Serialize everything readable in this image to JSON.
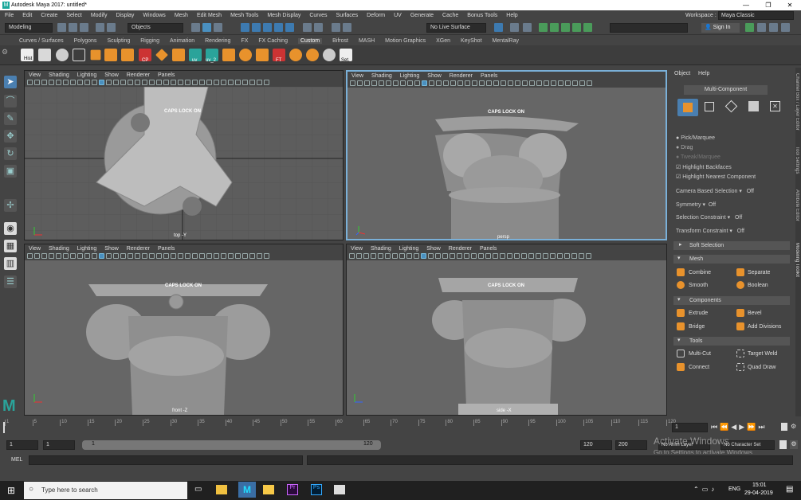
{
  "window": {
    "title": "Autodesk Maya 2017: untitled*"
  },
  "menu": [
    "File",
    "Edit",
    "Create",
    "Select",
    "Modify",
    "Display",
    "Windows",
    "Mesh",
    "Edit Mesh",
    "Mesh Tools",
    "Mesh Display",
    "Curves",
    "Surfaces",
    "Deform",
    "UV",
    "Generate",
    "Cache",
    "Bonus Tools",
    "Help"
  ],
  "workspace": {
    "label": "Workspace :",
    "value": "Maya Classic"
  },
  "status": {
    "mode": "Modeling",
    "objects": "Objects",
    "live": "No Live Surface",
    "signin": "Sign In"
  },
  "shelf_tabs": [
    "Curves / Surfaces",
    "Polygons",
    "Sculpting",
    "Rigging",
    "Animation",
    "Rendering",
    "FX",
    "FX Caching",
    "Custom",
    "Bifrost",
    "MASH",
    "Motion Graphics",
    "XGen",
    "KeyShot",
    "MentalRay"
  ],
  "shelf_active": "Custom",
  "shelf_labels": {
    "hist": "Hist",
    "cp": "CP",
    "uv": "uv",
    "uv2": "uv_2",
    "ft": "FT",
    "set": "Set."
  },
  "viewport_menu": [
    "View",
    "Shading",
    "Lighting",
    "Show",
    "Renderer",
    "Panels"
  ],
  "viewports": [
    {
      "caps": "CAPS LOCK ON",
      "camera": "top -Y"
    },
    {
      "caps": "CAPS LOCK ON",
      "camera": "persp"
    },
    {
      "caps": "CAPS LOCK ON",
      "camera": "front -Z"
    },
    {
      "caps": "CAPS LOCK ON",
      "camera": "side -X"
    }
  ],
  "right_panel": {
    "menu": [
      "Object",
      "Help"
    ],
    "mode": "Multi-Component",
    "pick": "Pick/Marquee",
    "drag": "Drag",
    "tweak": "Tweak/Marquee",
    "backfaces": "Highlight Backfaces",
    "nearest": "Highlight Nearest Component",
    "camera_sel": "Camera Based Selection",
    "camera_sel_val": "Off",
    "symmetry": "Symmetry",
    "symmetry_val": "Off",
    "sel_constraint": "Selection Constraint",
    "sel_constraint_val": "Off",
    "xform_constraint": "Transform Constraint",
    "xform_constraint_val": "Off",
    "soft": "Soft Selection",
    "mesh": "Mesh",
    "combine": "Combine",
    "separate": "Separate",
    "smooth": "Smooth",
    "boolean": "Boolean",
    "components": "Components",
    "extrude": "Extrude",
    "bevel": "Bevel",
    "bridge": "Bridge",
    "add_div": "Add Divisions",
    "tools": "Tools",
    "multicut": "Multi-Cut",
    "target_weld": "Target Weld",
    "connect": "Connect",
    "quad_draw": "Quad Draw"
  },
  "side_tabs": [
    "Channel Box / Layer Editor",
    "Tool Settings",
    "Attribute Editor",
    "Modeling Toolkit"
  ],
  "timeline": {
    "ticks": [
      "1",
      "5",
      "10",
      "15",
      "20",
      "25",
      "30",
      "35",
      "40",
      "45",
      "50",
      "55",
      "60",
      "65",
      "70",
      "75",
      "80",
      "85",
      "90",
      "95",
      "100",
      "105",
      "110",
      "115",
      "120"
    ],
    "current": "1"
  },
  "range": {
    "start": "1",
    "start2": "1",
    "inner_start": "1",
    "inner_end": "120",
    "end": "120",
    "end2": "200",
    "anim_layer": "No Anim Layer",
    "char_set": "No Character Set"
  },
  "mel": "MEL",
  "watermark": {
    "line1": "Activate Windows",
    "line2": "Go to Settings to activate Windows."
  },
  "taskbar": {
    "search": "Type here to search",
    "lang": "ENG",
    "time": "15:01",
    "date": "29-04-2019"
  }
}
